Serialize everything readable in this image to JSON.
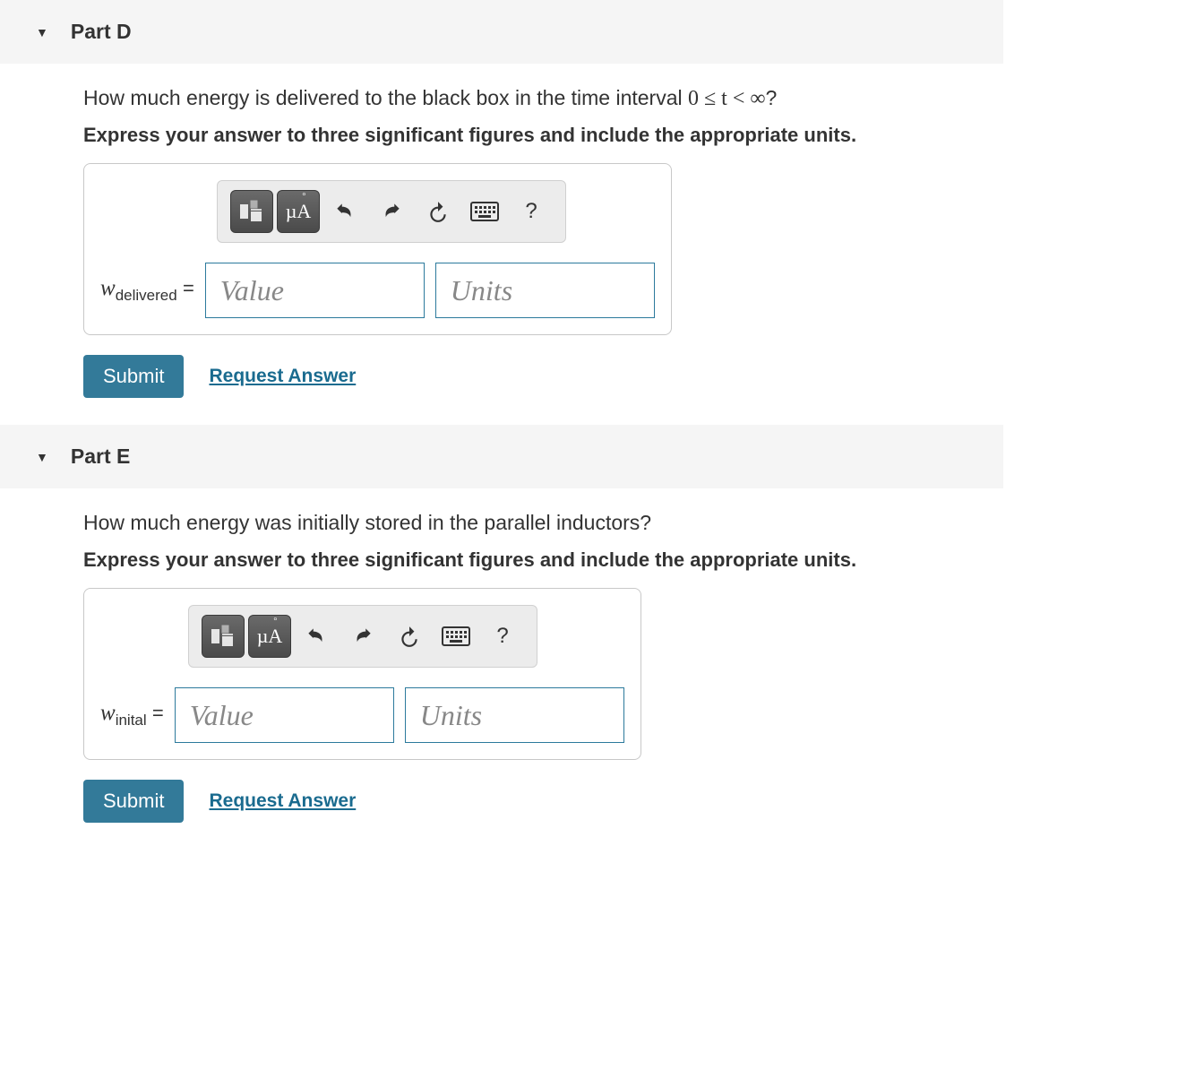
{
  "parts": {
    "D": {
      "title": "Part D",
      "question_pre": "How much energy is delivered to the black box in the time interval ",
      "question_math": "0 ≤ t < ∞",
      "question_post": "?",
      "hint": "Express your answer to three significant figures and include the appropriate units.",
      "var_symbol": "w",
      "var_sub": "delivered",
      "value_placeholder": "Value",
      "units_placeholder": "Units",
      "submit_label": "Submit",
      "request_label": "Request Answer"
    },
    "E": {
      "title": "Part E",
      "question_pre": "How much energy was initially stored in the parallel inductors?",
      "question_math": "",
      "question_post": "",
      "hint": "Express your answer to three significant figures and include the appropriate units.",
      "var_symbol": "w",
      "var_sub": "inital",
      "value_placeholder": "Value",
      "units_placeholder": "Units",
      "submit_label": "Submit",
      "request_label": "Request Answer"
    }
  },
  "toolbar": {
    "template_label": "templates",
    "symbols_label": "µÅ",
    "undo": "undo",
    "redo": "redo",
    "reset": "reset",
    "keyboard": "keyboard",
    "help": "?"
  }
}
